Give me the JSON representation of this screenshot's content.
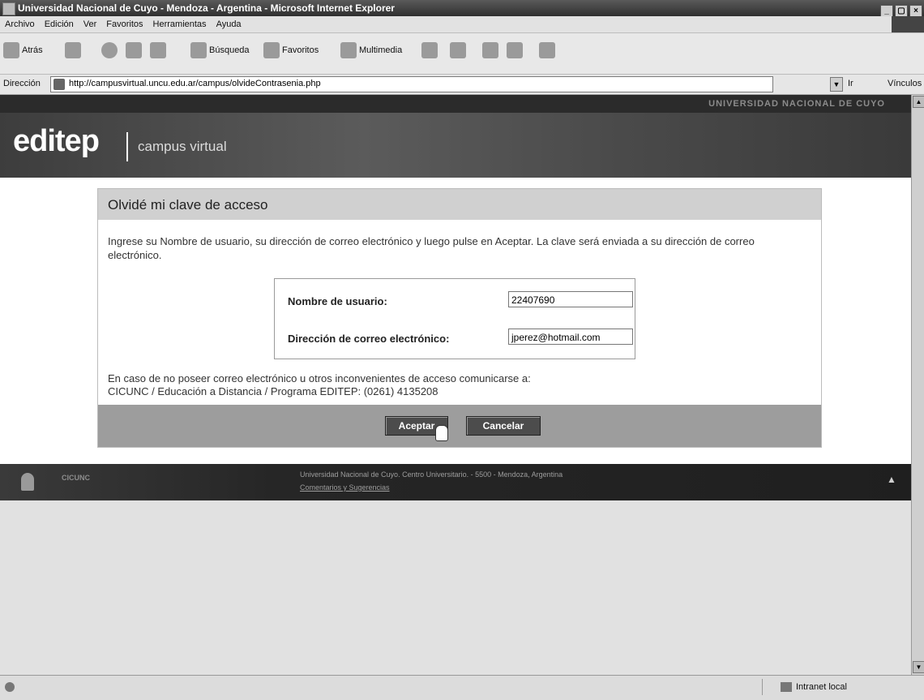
{
  "window": {
    "title": "Universidad Nacional de Cuyo - Mendoza - Argentina - Microsoft Internet Explorer",
    "controls": [
      "_",
      "▢",
      "×"
    ]
  },
  "menubar": {
    "items": [
      "Archivo",
      "Edición",
      "Ver",
      "Favoritos",
      "Herramientas",
      "Ayuda"
    ]
  },
  "toolbar": {
    "back": "Atrás",
    "search": "Búsqueda",
    "favorites": "Favoritos",
    "multimedia": "Multimedia"
  },
  "addressbar": {
    "label": "Dirección",
    "url": "http://campusvirtual.uncu.edu.ar/campus/olvideContrasenia.php",
    "go": "Ir",
    "links": "Vínculos"
  },
  "site": {
    "university": "UNIVERSIDAD NACIONAL DE CUYO",
    "logo": "editep",
    "tagline": "campus virtual"
  },
  "panel": {
    "title": "Olvidé mi clave de acceso",
    "intro": "Ingrese su Nombre de usuario, su dirección de correo electrónico y luego pulse en Aceptar. La clave será enviada a su dirección de correo electrónico.",
    "username_label": "Nombre de usuario:",
    "username_value": "22407690",
    "email_label": "Dirección de correo electrónico:",
    "email_value": "jperez@hotmail.com",
    "note_line1": "En caso de no poseer correo electrónico u otros inconvenientes de acceso comunicarse a:",
    "note_line2": "CICUNC / Educación a Distancia / Programa EDITEP: (0261) 4135208",
    "accept_label": "Aceptar",
    "cancel_label": "Cancelar"
  },
  "footer": {
    "org": "CICUNC",
    "address": "Universidad Nacional de Cuyo. Centro Universitario. - 5500 - Mendoza, Argentina",
    "link": "Comentarios y Sugerencias"
  },
  "statusbar": {
    "zone": "Intranet local"
  }
}
